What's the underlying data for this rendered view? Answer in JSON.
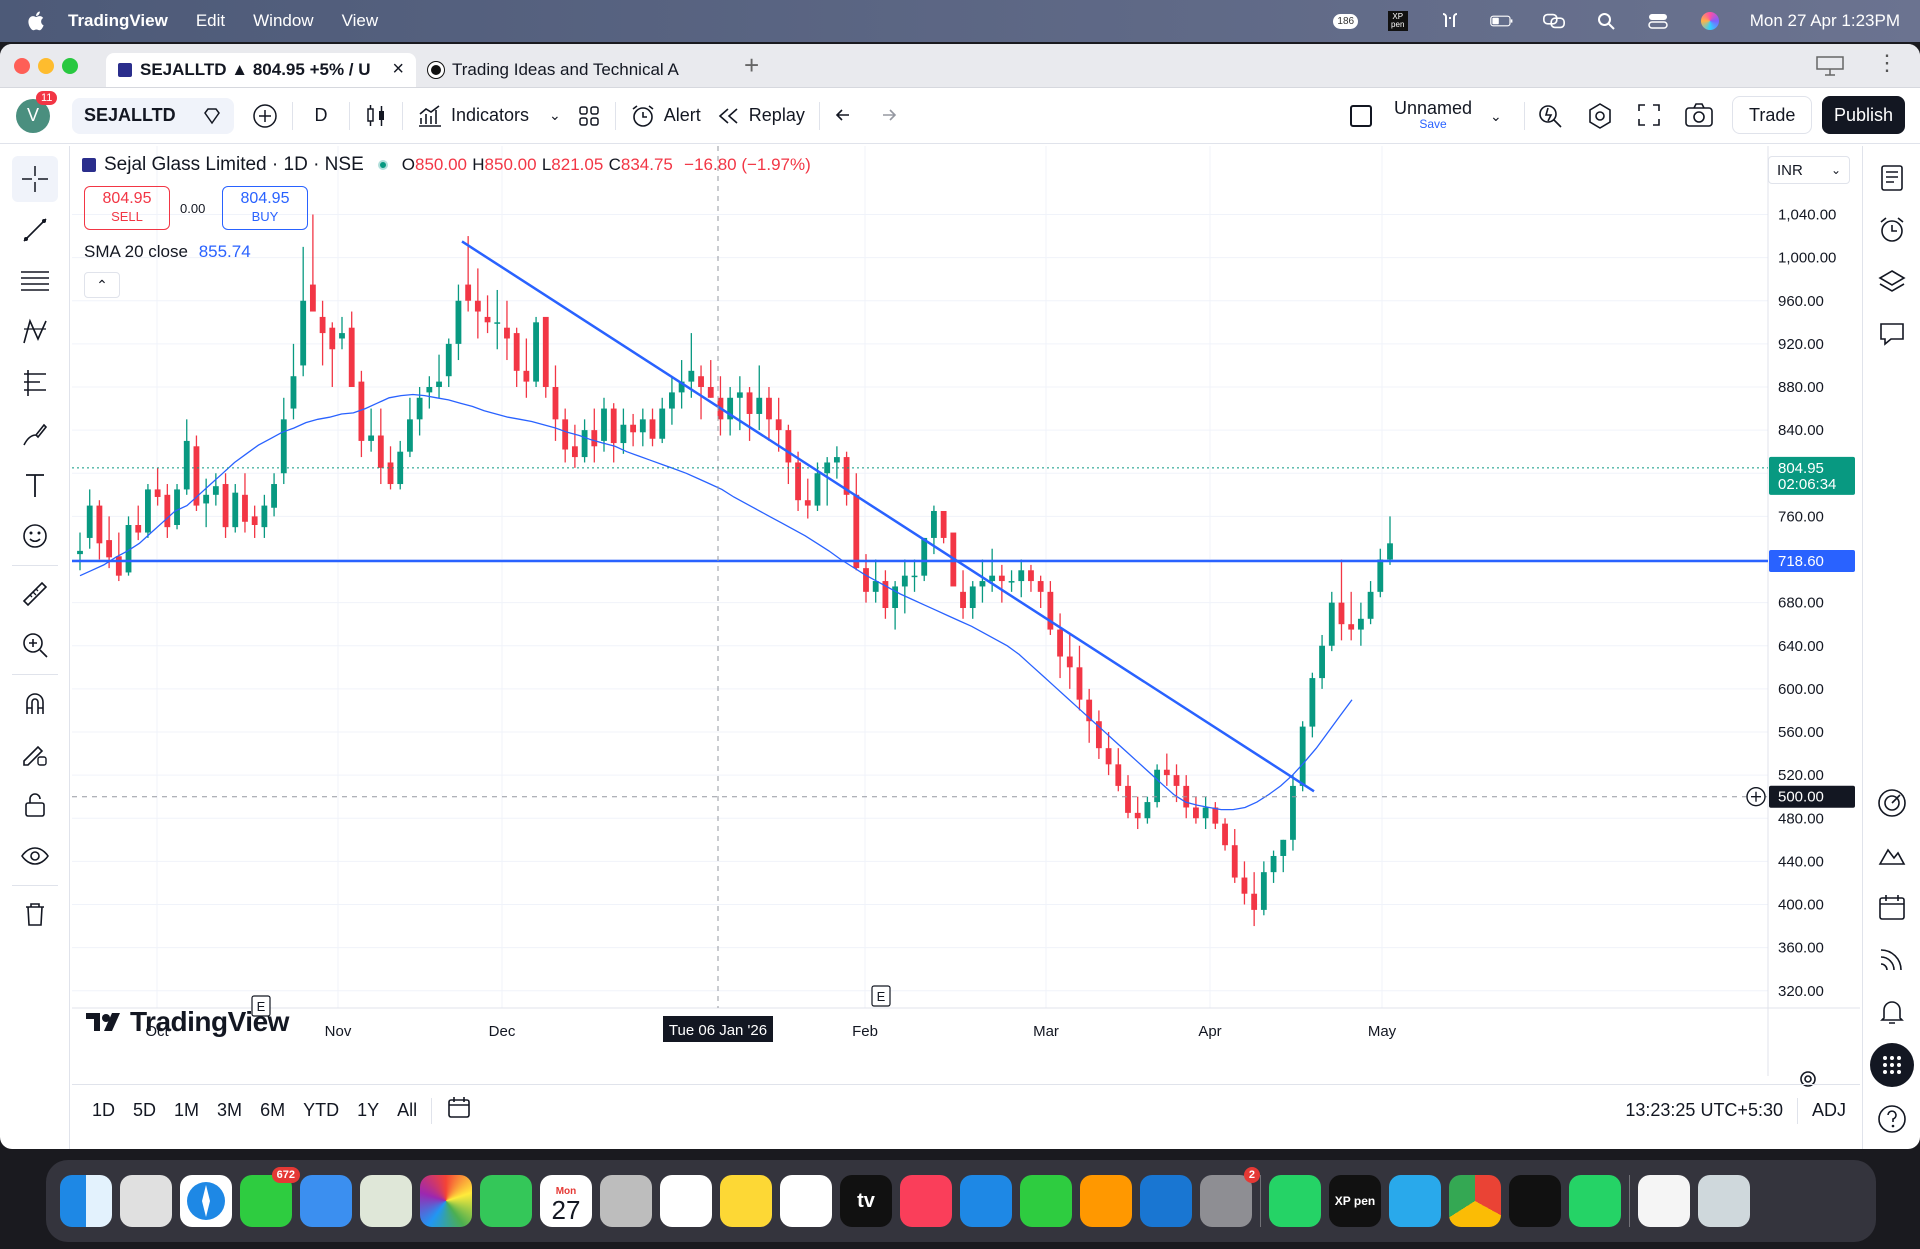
{
  "menubar": {
    "app": "TradingView",
    "items": [
      "Edit",
      "Window",
      "View"
    ],
    "clock": "Mon 27 Apr  1:23PM",
    "badge_num": "186",
    "xp_label": "XP pen"
  },
  "tabs": [
    {
      "label": "SEJALLTD ▲ 804.95 +5% / U"
    },
    {
      "label": "Trading Ideas and Technical A"
    }
  ],
  "toolbar": {
    "avatar": "V",
    "avatar_badge": "11",
    "symbol": "SEJALLTD",
    "interval": "D",
    "indicators": "Indicators",
    "alert": "Alert",
    "replay": "Replay",
    "layout_name": "Unnamed",
    "layout_sub": "Save",
    "trade": "Trade",
    "publish": "Publish"
  },
  "legend": {
    "title": "Sejal Glass Limited · 1D · NSE",
    "o_label": "O",
    "o": "850.00",
    "h_label": "H",
    "h": "850.00",
    "l_label": "L",
    "l": "821.05",
    "c_label": "C",
    "c": "834.75",
    "chg": "−16.80 (−1.97%)",
    "sell_price": "804.95",
    "sell_label": "SELL",
    "spread": "0.00",
    "buy_price": "804.95",
    "buy_label": "BUY",
    "sma_label": "SMA 20 close",
    "sma_value": "855.74",
    "currency": "INR"
  },
  "price_axis": {
    "ticks": [
      "1,040.00",
      "1,000.00",
      "960.00",
      "920.00",
      "880.00",
      "840.00",
      "760.00",
      "680.00",
      "640.00",
      "600.00",
      "560.00",
      "520.00",
      "480.00",
      "440.00",
      "400.00",
      "360.00",
      "320.00"
    ],
    "last_price": "804.95",
    "countdown": "02:06:34",
    "hline_price": "718.60",
    "cursor_price": "500.00"
  },
  "time_axis": {
    "labels": [
      "Oct",
      "Nov",
      "Dec",
      "Feb",
      "Mar",
      "Apr",
      "May"
    ],
    "cursor_label": "Tue 06 Jan '26"
  },
  "watermark": "TradingView",
  "bottombar": {
    "ranges": [
      "1D",
      "5D",
      "1M",
      "3M",
      "6M",
      "YTD",
      "1Y",
      "All"
    ],
    "clock": "13:23:25 UTC+5:30",
    "adj": "ADJ"
  },
  "dock": {
    "messages_badge": "672",
    "cal_month": "Mon",
    "cal_day": "27",
    "settings_badge": "2",
    "tv_label": "tv",
    "xp_label": "XP pen"
  },
  "colors": {
    "up": "#089981",
    "down": "#f23645",
    "trendline": "#2962ff",
    "sma": "#2962ff",
    "accent": "#2962ff"
  },
  "chart_data": {
    "type": "candlestick",
    "symbol": "SEJALLTD",
    "exchange": "NSE",
    "interval": "1D",
    "title": "Sejal Glass Limited",
    "ylim": [
      320,
      1060
    ],
    "y_scale": "linear",
    "grid": true,
    "ohlc": [
      [
        725,
        745,
        710,
        728
      ],
      [
        740,
        785,
        730,
        770
      ],
      [
        770,
        775,
        720,
        735
      ],
      [
        738,
        760,
        712,
        722
      ],
      [
        723,
        745,
        700,
        705
      ],
      [
        708,
        760,
        705,
        752
      ],
      [
        752,
        770,
        738,
        745
      ],
      [
        745,
        790,
        740,
        785
      ],
      [
        785,
        805,
        770,
        778
      ],
      [
        780,
        790,
        740,
        750
      ],
      [
        752,
        790,
        748,
        785
      ],
      [
        785,
        850,
        780,
        830
      ],
      [
        825,
        835,
        765,
        770
      ],
      [
        772,
        795,
        750,
        780
      ],
      [
        780,
        800,
        770,
        788
      ],
      [
        790,
        800,
        740,
        750
      ],
      [
        750,
        790,
        745,
        782
      ],
      [
        780,
        800,
        745,
        755
      ],
      [
        760,
        770,
        740,
        752
      ],
      [
        750,
        780,
        740,
        770
      ],
      [
        768,
        800,
        760,
        790
      ],
      [
        800,
        870,
        790,
        850
      ],
      [
        860,
        920,
        850,
        890
      ],
      [
        900,
        1010,
        890,
        960
      ],
      [
        975,
        1040,
        960,
        950
      ],
      [
        945,
        960,
        900,
        930
      ],
      [
        935,
        940,
        880,
        915
      ],
      [
        925,
        945,
        915,
        930
      ],
      [
        935,
        950,
        880,
        880
      ],
      [
        885,
        895,
        815,
        830
      ],
      [
        830,
        860,
        820,
        835
      ],
      [
        835,
        860,
        790,
        805
      ],
      [
        810,
        825,
        785,
        790
      ],
      [
        790,
        830,
        785,
        820
      ],
      [
        820,
        870,
        815,
        850
      ],
      [
        850,
        880,
        835,
        870
      ],
      [
        875,
        890,
        860,
        880
      ],
      [
        880,
        910,
        870,
        885
      ],
      [
        890,
        925,
        880,
        920
      ],
      [
        920,
        975,
        905,
        960
      ],
      [
        975,
        1020,
        950,
        960
      ],
      [
        960,
        990,
        925,
        950
      ],
      [
        945,
        965,
        930,
        940
      ],
      [
        940,
        970,
        915,
        940
      ],
      [
        935,
        960,
        905,
        925
      ],
      [
        930,
        935,
        880,
        895
      ],
      [
        895,
        925,
        870,
        885
      ],
      [
        885,
        945,
        880,
        940
      ],
      [
        945,
        940,
        870,
        880
      ],
      [
        880,
        900,
        830,
        850
      ],
      [
        850,
        860,
        810,
        822
      ],
      [
        825,
        845,
        805,
        815
      ],
      [
        815,
        850,
        810,
        840
      ],
      [
        840,
        860,
        810,
        825
      ],
      [
        830,
        870,
        820,
        860
      ],
      [
        860,
        865,
        810,
        828
      ],
      [
        828,
        860,
        818,
        845
      ],
      [
        845,
        855,
        825,
        838
      ],
      [
        838,
        860,
        825,
        850
      ],
      [
        850,
        860,
        825,
        832
      ],
      [
        832,
        870,
        828,
        860
      ],
      [
        860,
        890,
        845,
        875
      ],
      [
        875,
        905,
        860,
        885
      ],
      [
        885,
        930,
        870,
        895
      ],
      [
        890,
        900,
        850,
        880
      ],
      [
        880,
        905,
        870,
        870
      ],
      [
        870,
        890,
        835,
        850
      ],
      [
        850,
        880,
        835,
        870
      ],
      [
        870,
        890,
        840,
        875
      ],
      [
        875,
        880,
        830,
        855
      ],
      [
        855,
        900,
        840,
        870
      ],
      [
        870,
        880,
        830,
        850
      ],
      [
        850,
        870,
        820,
        840
      ],
      [
        840,
        845,
        790,
        810
      ],
      [
        810,
        820,
        765,
        775
      ],
      [
        775,
        795,
        758,
        770
      ],
      [
        770,
        810,
        765,
        800
      ],
      [
        800,
        815,
        770,
        810
      ],
      [
        810,
        825,
        795,
        815
      ],
      [
        815,
        820,
        770,
        780
      ],
      [
        780,
        800,
        710,
        712
      ],
      [
        712,
        725,
        680,
        690
      ],
      [
        690,
        720,
        680,
        700
      ],
      [
        700,
        710,
        665,
        675
      ],
      [
        675,
        700,
        655,
        695
      ],
      [
        695,
        720,
        670,
        705
      ],
      [
        705,
        720,
        690,
        705
      ],
      [
        705,
        740,
        700,
        740
      ],
      [
        740,
        770,
        725,
        765
      ],
      [
        765,
        760,
        735,
        740
      ],
      [
        745,
        740,
        700,
        695
      ],
      [
        690,
        710,
        665,
        675
      ],
      [
        675,
        700,
        665,
        695
      ],
      [
        695,
        720,
        680,
        700
      ],
      [
        700,
        730,
        690,
        705
      ],
      [
        705,
        715,
        680,
        700
      ],
      [
        700,
        710,
        690,
        700
      ],
      [
        700,
        720,
        685,
        710
      ],
      [
        710,
        715,
        690,
        700
      ],
      [
        700,
        705,
        675,
        690
      ],
      [
        690,
        700,
        650,
        655
      ],
      [
        655,
        670,
        610,
        630
      ],
      [
        630,
        650,
        600,
        620
      ],
      [
        620,
        640,
        580,
        590
      ],
      [
        590,
        600,
        550,
        570
      ],
      [
        570,
        580,
        535,
        545
      ],
      [
        545,
        560,
        520,
        530
      ],
      [
        530,
        545,
        505,
        510
      ],
      [
        510,
        520,
        480,
        485
      ],
      [
        485,
        500,
        470,
        480
      ],
      [
        480,
        500,
        475,
        495
      ],
      [
        495,
        530,
        490,
        525
      ],
      [
        525,
        540,
        510,
        520
      ],
      [
        520,
        530,
        495,
        510
      ],
      [
        510,
        520,
        480,
        490
      ],
      [
        490,
        500,
        475,
        480
      ],
      [
        480,
        500,
        470,
        490
      ],
      [
        490,
        495,
        470,
        475
      ],
      [
        475,
        480,
        450,
        455
      ],
      [
        455,
        470,
        420,
        425
      ],
      [
        425,
        440,
        400,
        410
      ],
      [
        410,
        430,
        380,
        395
      ],
      [
        395,
        440,
        390,
        430
      ],
      [
        430,
        450,
        420,
        445
      ],
      [
        445,
        460,
        430,
        460
      ],
      [
        460,
        520,
        450,
        510
      ],
      [
        510,
        570,
        505,
        565
      ],
      [
        565,
        615,
        555,
        610
      ],
      [
        610,
        650,
        600,
        640
      ],
      [
        640,
        690,
        635,
        680
      ],
      [
        680,
        720,
        645,
        660
      ],
      [
        660,
        690,
        645,
        655
      ],
      [
        655,
        680,
        640,
        665
      ],
      [
        665,
        700,
        660,
        690
      ],
      [
        690,
        730,
        685,
        720
      ],
      [
        720,
        760,
        715,
        735
      ]
    ],
    "sma20_close": [
      705,
      710,
      715,
      722,
      728,
      735,
      745,
      755,
      765,
      770,
      780,
      790,
      800,
      810,
      818,
      826,
      832,
      838,
      842,
      847,
      850,
      852,
      855,
      856,
      860,
      865,
      870,
      872,
      873,
      872,
      870,
      868,
      865,
      862,
      858,
      855,
      852,
      850,
      848,
      845,
      842,
      838,
      835,
      831,
      828,
      825,
      820,
      816,
      812,
      808,
      804,
      800,
      795,
      790,
      785,
      778,
      772,
      766,
      760,
      754,
      748,
      742,
      735,
      728,
      720,
      713,
      706,
      700,
      694,
      688,
      683,
      678,
      673,
      668,
      663,
      658,
      652,
      646,
      640,
      632,
      622,
      612,
      602,
      592,
      582,
      572,
      562,
      552,
      542,
      532,
      522,
      512,
      502,
      495,
      492,
      490,
      488,
      488,
      490,
      495,
      502,
      510,
      520,
      532,
      545,
      560,
      575,
      590
    ]
  }
}
